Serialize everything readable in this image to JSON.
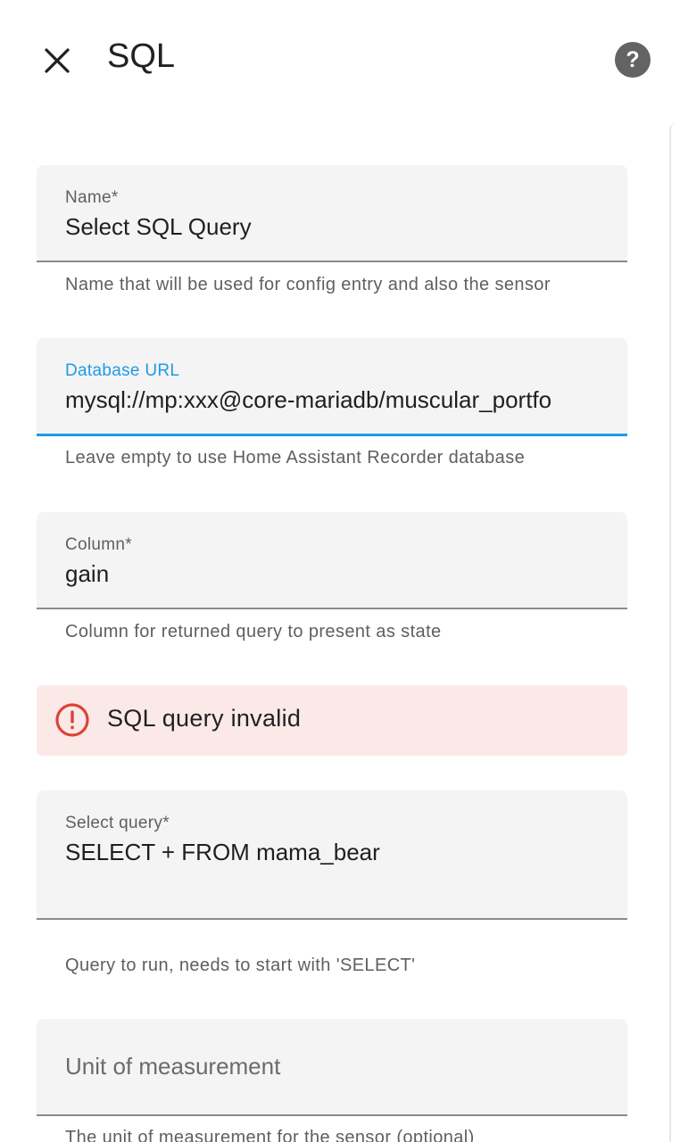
{
  "dialog": {
    "title": "SQL",
    "close_icon": "close-icon",
    "help_icon": "help-circle-icon"
  },
  "fields": {
    "name": {
      "label": "Name*",
      "value": "Select SQL Query",
      "helper": "Name that will be used for config entry and also the sensor"
    },
    "db_url": {
      "label": "Database URL",
      "value": "mysql://mp:xxx@core-mariadb/muscular_portfo",
      "helper": "Leave empty to use Home Assistant Recorder database"
    },
    "column": {
      "label": "Column*",
      "value": "gain",
      "helper": "Column for returned query to present as state"
    },
    "query": {
      "label": "Select query*",
      "value": "SELECT + FROM mama_bear",
      "helper": "Query to run, needs to start with 'SELECT'"
    },
    "unit": {
      "label": "Unit of measurement",
      "helper": "The unit of measurement for the sensor (optional)"
    }
  },
  "alert": {
    "icon": "alert-circle-icon",
    "text": "SQL query invalid"
  },
  "colors": {
    "accent": "#1e9be6",
    "error": "#db4437",
    "error_bg": "#fbe9e8",
    "field_bg": "#f4f4f4"
  }
}
